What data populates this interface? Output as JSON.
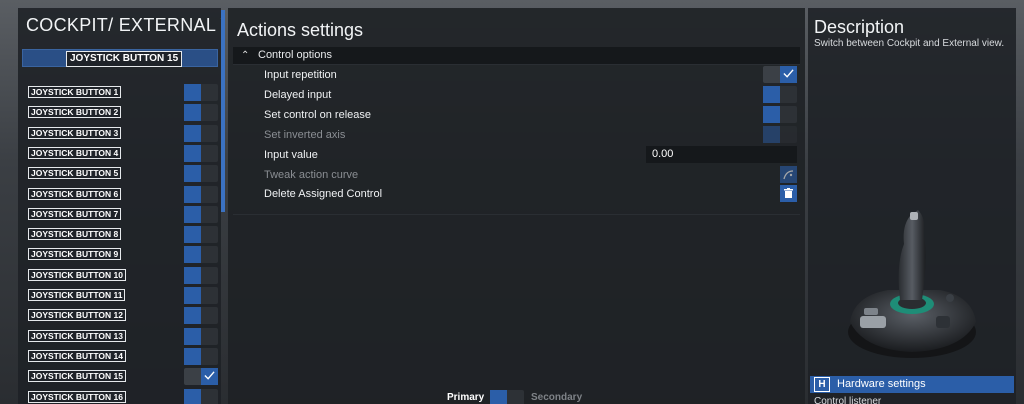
{
  "left_panel": {
    "title": "COCKPIT/ EXTERNAL VIE",
    "selected_label": "JOYSTICK BUTTON 15",
    "buttons": [
      {
        "label": "JOYSTICK BUTTON 1",
        "state": "off"
      },
      {
        "label": "JOYSTICK BUTTON 2",
        "state": "off"
      },
      {
        "label": "JOYSTICK BUTTON 3",
        "state": "off"
      },
      {
        "label": "JOYSTICK BUTTON 4",
        "state": "off"
      },
      {
        "label": "JOYSTICK BUTTON 5",
        "state": "off"
      },
      {
        "label": "JOYSTICK BUTTON 6",
        "state": "off"
      },
      {
        "label": "JOYSTICK BUTTON 7",
        "state": "off"
      },
      {
        "label": "JOYSTICK BUTTON 8",
        "state": "off"
      },
      {
        "label": "JOYSTICK BUTTON 9",
        "state": "off"
      },
      {
        "label": "JOYSTICK BUTTON 10",
        "state": "off"
      },
      {
        "label": "JOYSTICK BUTTON 11",
        "state": "off"
      },
      {
        "label": "JOYSTICK BUTTON 12",
        "state": "off"
      },
      {
        "label": "JOYSTICK BUTTON 13",
        "state": "off"
      },
      {
        "label": "JOYSTICK BUTTON 14",
        "state": "off"
      },
      {
        "label": "JOYSTICK BUTTON 15",
        "state": "checked"
      },
      {
        "label": "JOYSTICK BUTTON 16",
        "state": "off"
      }
    ]
  },
  "actions": {
    "title": "Actions settings",
    "section_label": "Control options",
    "options": {
      "input_repetition": {
        "label": "Input repetition",
        "state": "checked"
      },
      "delayed_input": {
        "label": "Delayed input",
        "state": "off"
      },
      "set_control_on_release": {
        "label": "Set control on release",
        "state": "off"
      },
      "set_inverted_axis": {
        "label": "Set inverted axis",
        "state": "disabled"
      },
      "input_value": {
        "label": "Input value",
        "value": "0.00"
      },
      "tweak_action_curve": {
        "label": "Tweak action curve",
        "icon": "curve-icon"
      },
      "delete_assigned_control": {
        "label": "Delete Assigned Control",
        "icon": "trash-icon"
      }
    },
    "primary_label": "Primary",
    "secondary_label": "Secondary",
    "selected_slot": "Primary"
  },
  "description": {
    "title": "Description",
    "text": "Switch between Cockpit and External view.",
    "hardware_key": "H",
    "hardware_label": "Hardware settings",
    "next_item": "Control listener"
  },
  "colors": {
    "accent": "#2b5ea8",
    "panel": "#1e2125",
    "scrollbar": "#3b72c2"
  }
}
